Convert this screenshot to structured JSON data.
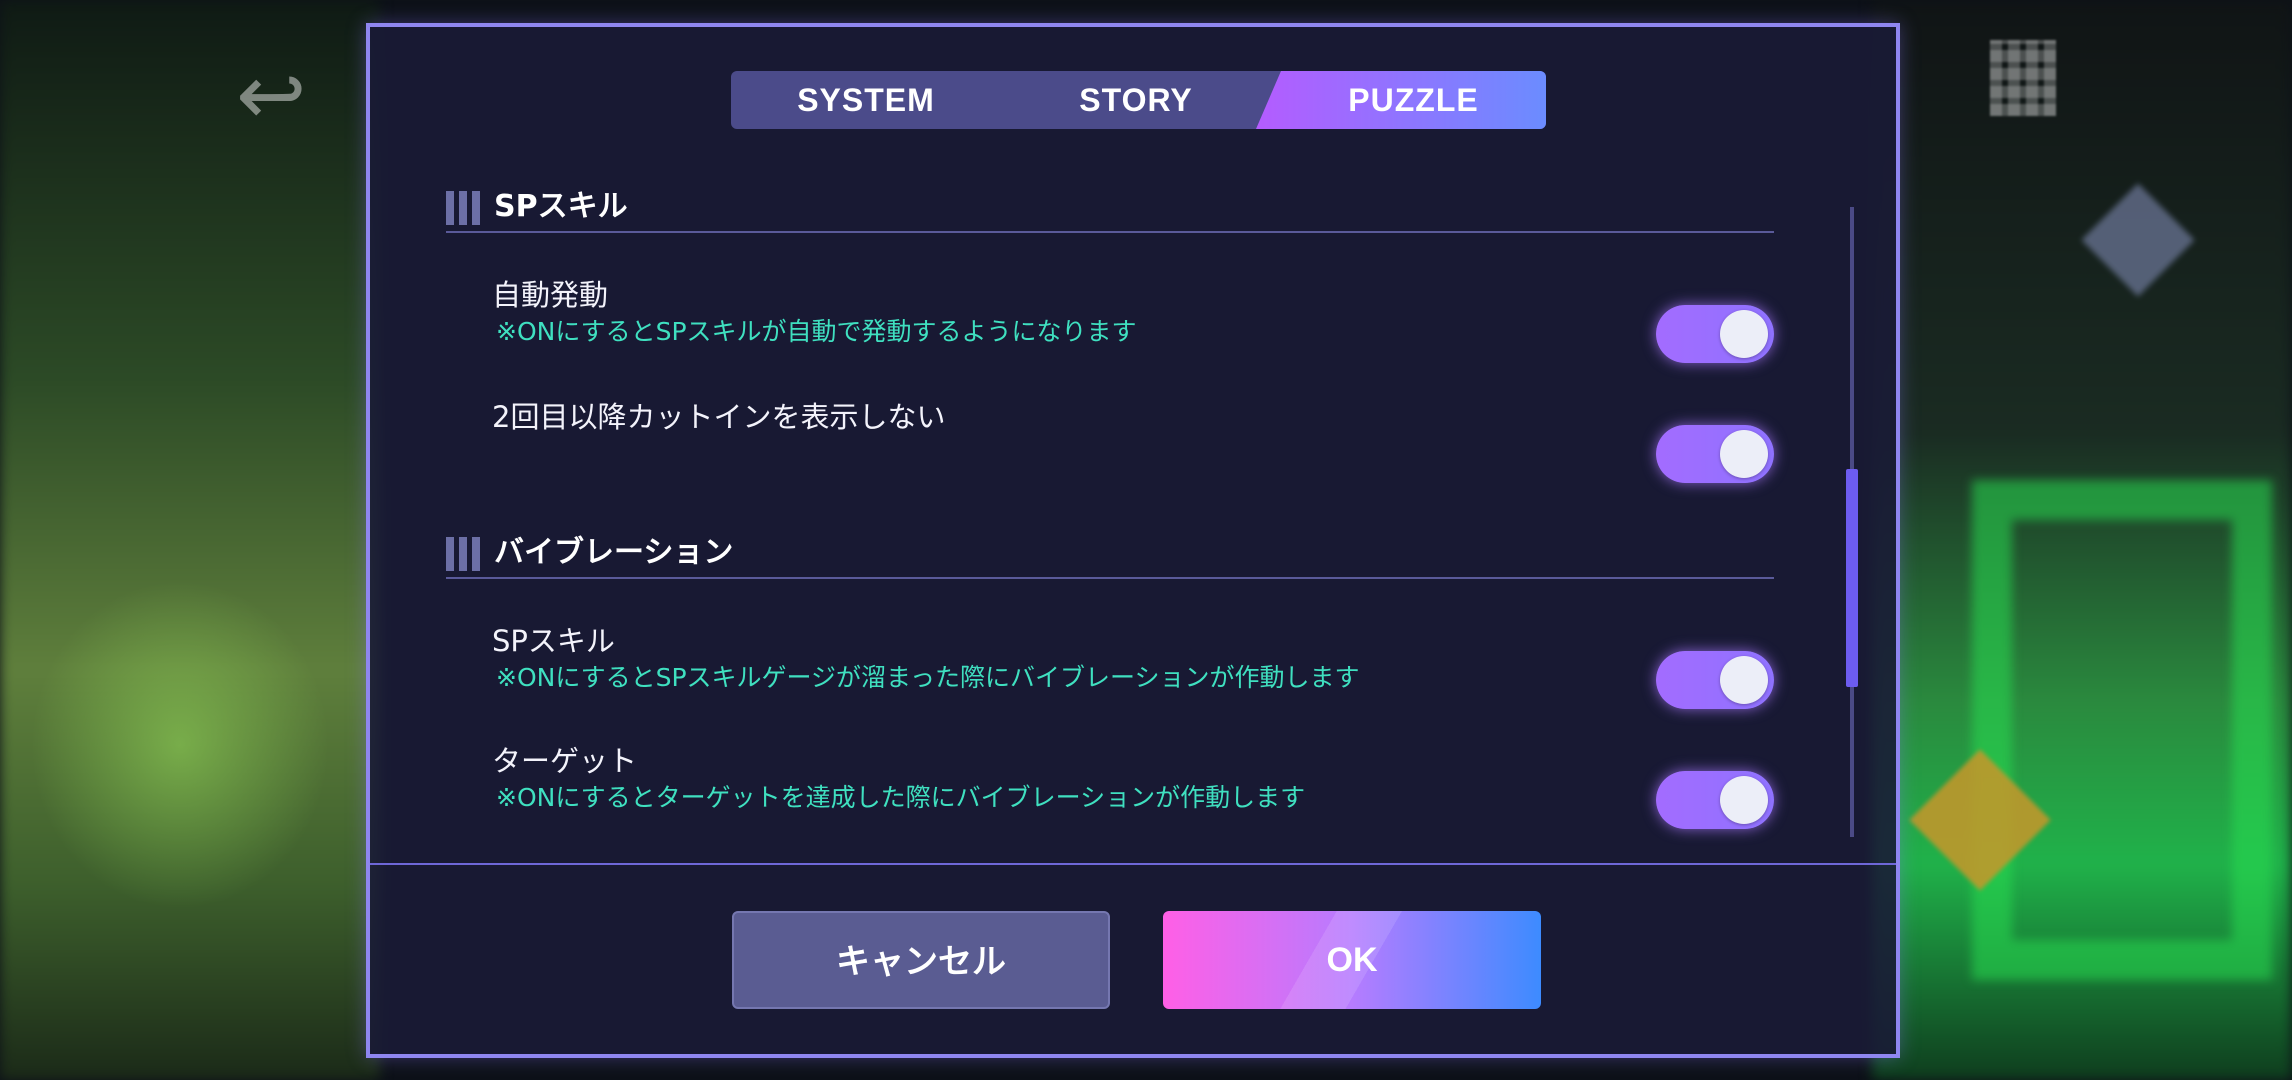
{
  "tabs": [
    {
      "label": "SYSTEM"
    },
    {
      "label": "STORY"
    },
    {
      "label": "PUZZLE"
    }
  ],
  "active_tab": "PUZZLE",
  "sections": [
    {
      "title": "SPスキル",
      "settings": [
        {
          "title": "自動発動",
          "description": "※ONにするとSPスキルが自動で発動するようになります",
          "enabled": true
        },
        {
          "title": "2回目以降カットインを表示しない",
          "description": "",
          "enabled": true
        }
      ]
    },
    {
      "title": "バイブレーション",
      "settings": [
        {
          "title": "SPスキル",
          "description": "※ONにするとSPスキルゲージが溜まった際にバイブレーションが作動します",
          "enabled": true
        },
        {
          "title": "ターゲット",
          "description": "※ONにするとターゲットを達成した際にバイブレーションが作動します",
          "enabled": true
        }
      ]
    }
  ],
  "buttons": {
    "cancel": "キャンセル",
    "ok": "OK"
  },
  "colors": {
    "accent_toggle": "#a36cff",
    "description_text": "#3fe0c0",
    "dialog_border": "#8f86f0"
  }
}
